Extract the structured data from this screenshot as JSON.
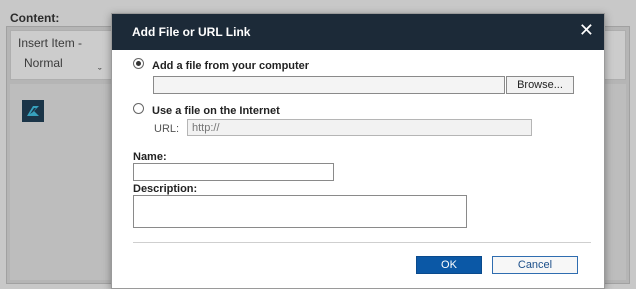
{
  "background": {
    "content_label": "Content:",
    "insert_item": "Insert Item -",
    "format_value": "Normal",
    "format_caret": "ˬ"
  },
  "dialog": {
    "title": "Add File or URL Link",
    "close_glyph": "✕",
    "option_computer": "Add a file from your computer",
    "browse_label": "Browse...",
    "option_internet": "Use a file on the Internet",
    "url_label": "URL:",
    "url_placeholder": "http://",
    "name_label": "Name:",
    "description_label": "Description:",
    "ok_label": "OK",
    "cancel_label": "Cancel",
    "selected_option": "computer"
  },
  "colors": {
    "header_bg": "#1c2a38",
    "primary_button": "#0b58a6"
  }
}
